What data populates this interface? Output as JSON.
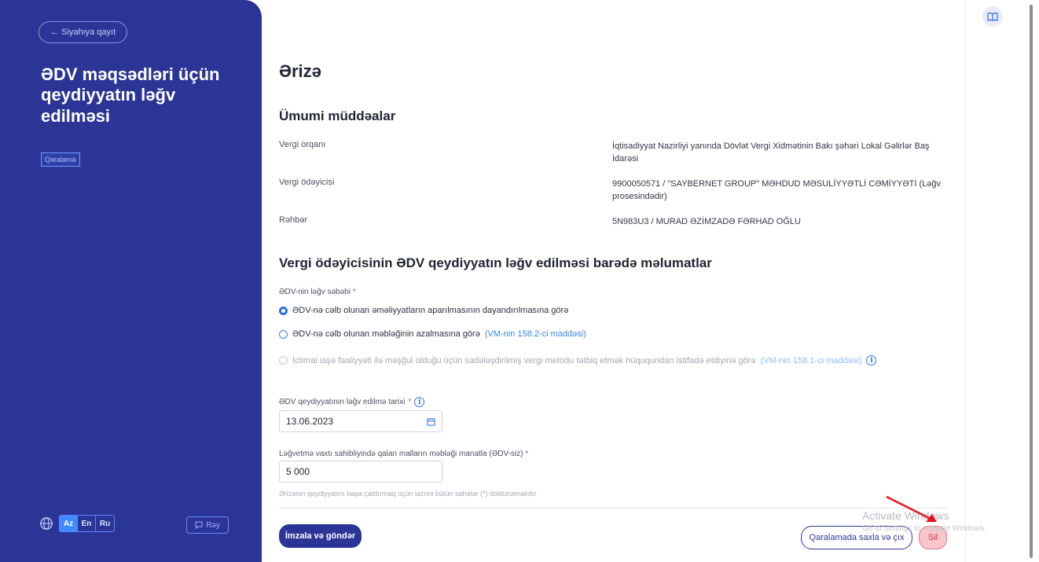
{
  "sidebar": {
    "back_label": "← Siyahıya qayıt",
    "title": "ƏDV məqsədləri üçün qeydiyyatın ləğv edilməsi",
    "status": "Qaralama",
    "languages": [
      "Az",
      "En",
      "Ru"
    ],
    "active_language": "Az",
    "feedback_label": "Rəy"
  },
  "main": {
    "title": "Ərizə",
    "general_section": {
      "title": "Ümumi müddəalar",
      "rows": [
        {
          "label": "Vergi orqanı",
          "value": "İqtisadiyyat Nazirliyi yanında Dövlət Vergi Xidmətinin Bakı şəhəri Lokal Gəlirlər Baş İdarəsi"
        },
        {
          "label": "Vergi ödəyicisi",
          "value": "9900050571 / \"SAYBERNET GROUP\" MƏHDUD MƏSULİYYƏTLİ CƏMİYYƏTİ (Ləğv prosesindədir)"
        },
        {
          "label": "Rəhbər",
          "value": "5N983U3 / MURAD ƏZİMZADƏ FƏRHAD OĞLU"
        }
      ]
    },
    "vat_section": {
      "title": "Vergi ödəyicisinin ƏDV qeydiyyatın ləğv edilməsi barədə məlumatlar",
      "reason_label": "ƏDV-nin ləğv səbəbi",
      "required_mark": "*",
      "options": [
        {
          "text": "ƏDV-nə cəlb olunan əməliyyatların aparılmasının dayandırılmasına görə",
          "link": "",
          "selected": true,
          "disabled": false
        },
        {
          "text": "ƏDV-nə cəlb olunan məbləğinin azalmasına görə",
          "link": "(VM-nin 158.2-ci maddəsi)",
          "selected": false,
          "disabled": false
        },
        {
          "text": "İctimai iaşə fəaliyyəti ilə məşğul olduğu üçün sadələşdirilmiş vergi metodu tətbiq etmək hüququndan istifadə etdiyinə görə",
          "link": "(VM-nin 158.1-ci maddəsi)",
          "selected": false,
          "disabled": true
        }
      ],
      "date_label": "ƏDV qeydiyyatının ləğv edilmə tarixi",
      "date_value": "13.06.2023",
      "amount_label": "Ləğvetmə vaxtı sahibliyində qalan malların məbləği manatla (ƏDV-siz)",
      "amount_value": "5 000",
      "hint": "Ərizənin qeydiyyatını başa çatdırmaq üçün lazımi bütün sahələr (*) doldurulmalıdır"
    },
    "actions": {
      "sign_send": "İmzala və göndər",
      "save_draft_exit": "Qaralamada saxla və çıx",
      "delete": "Sil"
    }
  },
  "overlay": {
    "watermark_title": "Activate Windows",
    "watermark_sub": "Go to Settings to activate Windows."
  },
  "colors": {
    "sidebar": "#2b3596",
    "accent": "#3a86ea",
    "danger": "#d1343f"
  }
}
